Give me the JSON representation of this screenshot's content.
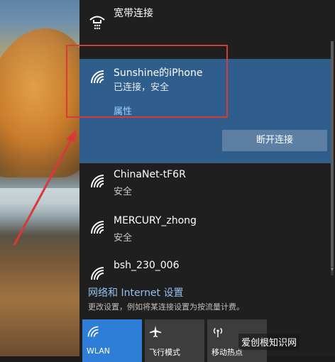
{
  "broadband": {
    "label": "宽带连接"
  },
  "connected": {
    "ssid": "Sunshine的iPhone",
    "status": "已连接，安全",
    "properties_link": "属性",
    "disconnect_label": "断开连接"
  },
  "networks": [
    {
      "ssid": "ChinaNet-tF6R",
      "status": "安全"
    },
    {
      "ssid": "MERCURY_zhong",
      "status": "安全"
    },
    {
      "ssid": "bsh_230_006",
      "status": ""
    }
  ],
  "settings": {
    "title": "网络和 Internet 设置",
    "description": "更改设置，例如将某连接设置为按流量计费。"
  },
  "quick_actions": [
    {
      "label": "WLAN",
      "icon": "wifi-icon",
      "active": true
    },
    {
      "label": "飞行模式",
      "icon": "airplane-icon",
      "active": false
    },
    {
      "label": "移动热点",
      "icon": "hotspot-icon",
      "active": false
    }
  ],
  "watermark": {
    "text": "爱创根知识网"
  },
  "colors": {
    "panel_bg": "#1f1f1f",
    "selected_bg": "#2f5e8c",
    "button_bg": "#5d7fa3",
    "accent_tile": "#2e7dd6",
    "annotation": "#d83a3a"
  }
}
